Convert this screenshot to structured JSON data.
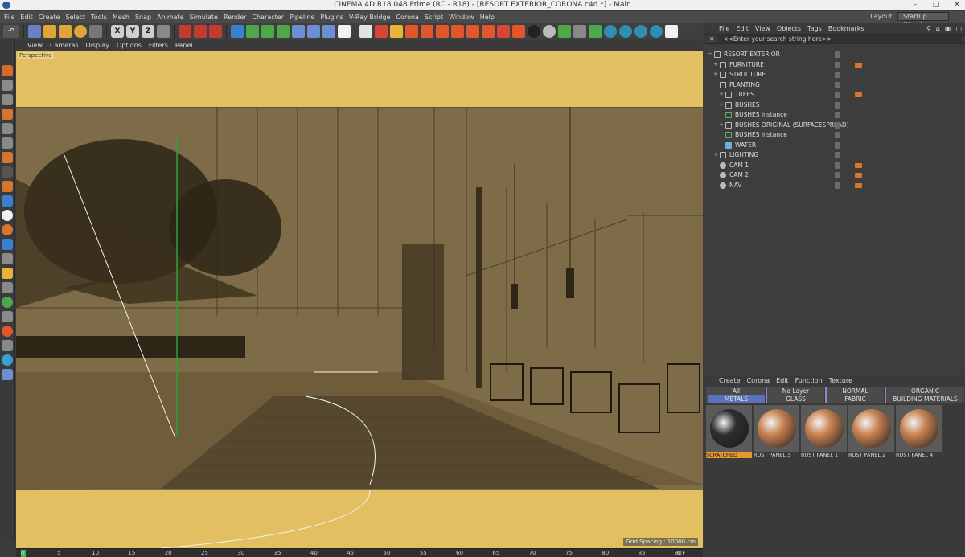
{
  "window": {
    "title": "CINEMA 4D R18.048 Prime (RC - R18) - [RESORT EXTERIOR_CORONA.c4d *] - Main",
    "controls": [
      "–",
      "□",
      "✕"
    ]
  },
  "menubar": {
    "items": [
      "File",
      "Edit",
      "Create",
      "Select",
      "Tools",
      "Mesh",
      "Snap",
      "Animate",
      "Simulate",
      "Render",
      "Character",
      "Pipeline",
      "Plugins",
      "V-Ray Bridge",
      "Corona",
      "Script",
      "Window",
      "Help"
    ],
    "layout_label": "Layout:",
    "layout_value": "Startup (User)"
  },
  "toolbar": {
    "axis_labels": [
      "X",
      "Y",
      "Z"
    ]
  },
  "viewport": {
    "menu": [
      "View",
      "Cameras",
      "Display",
      "Options",
      "Filters",
      "Panel"
    ],
    "label": "Perspective",
    "grid_spacing": "Grid Spacing : 10000 cm",
    "colors": {
      "background": "#e2c062",
      "scene": "#7e6c48"
    }
  },
  "timeline": {
    "ticks": [
      "0",
      "5",
      "10",
      "15",
      "20",
      "25",
      "30",
      "35",
      "40",
      "45",
      "50",
      "55",
      "60",
      "65",
      "70",
      "75",
      "80",
      "85",
      "90"
    ],
    "end_label": "0 F"
  },
  "object_manager": {
    "menu": [
      "File",
      "Edit",
      "View",
      "Objects",
      "Tags",
      "Bookmarks"
    ],
    "search_placeholder": "<<Enter your search string here>>",
    "objects": [
      {
        "name": "RESORT EXTERIOR",
        "depth": 0,
        "kind": "null",
        "expand": "−"
      },
      {
        "name": "FURNITURE",
        "depth": 1,
        "kind": "null",
        "expand": "+",
        "tag": "#d9742c"
      },
      {
        "name": "STRUCTURE",
        "depth": 1,
        "kind": "null",
        "expand": "+"
      },
      {
        "name": "PLANTING",
        "depth": 1,
        "kind": "null",
        "expand": "−"
      },
      {
        "name": "TREES",
        "depth": 2,
        "kind": "null",
        "expand": "+",
        "tag": "#d9742c"
      },
      {
        "name": "BUSHES",
        "depth": 2,
        "kind": "null",
        "expand": "+"
      },
      {
        "name": "BUSHES Instance",
        "depth": 2,
        "kind": "instance",
        "expand": ""
      },
      {
        "name": "BUSHES ORIGINAL (SURFACESPREAD)",
        "depth": 2,
        "kind": "null",
        "expand": "+"
      },
      {
        "name": "BUSHES Instance",
        "depth": 2,
        "kind": "instance",
        "expand": ""
      },
      {
        "name": "WATER",
        "depth": 2,
        "kind": "plane",
        "expand": ""
      },
      {
        "name": "LIGHTING",
        "depth": 1,
        "kind": "null",
        "expand": "+"
      },
      {
        "name": "CAM 1",
        "depth": 1,
        "kind": "camera",
        "expand": "",
        "tag": "#d9742c"
      },
      {
        "name": "CAM 2",
        "depth": 1,
        "kind": "camera",
        "expand": "",
        "tag": "#d9742c"
      },
      {
        "name": "NAV",
        "depth": 1,
        "kind": "camera",
        "expand": "",
        "tag": "#d9742c"
      }
    ]
  },
  "material_manager": {
    "menu": [
      "Create",
      "Corona",
      "Edit",
      "Function",
      "Texture"
    ],
    "filters_row1": [
      "All",
      "No Layer",
      "NORMAL",
      "ORGANIC"
    ],
    "filters_row2": [
      "METALS",
      "GLASS",
      "FABRIC",
      "BUILDING MATERIALS"
    ],
    "active_filter": "METALS",
    "materials": [
      {
        "name": "SCRATCHED",
        "color": "#2e2e2e",
        "selected": true
      },
      {
        "name": "RUST PANEL 3",
        "color": "#c98252",
        "selected": false
      },
      {
        "name": "RUST PANEL 1",
        "color": "#c98252",
        "selected": false
      },
      {
        "name": "RUST PANEL 2",
        "color": "#c98252",
        "selected": false
      },
      {
        "name": "RUST PANEL 4",
        "color": "#c98252",
        "selected": false
      }
    ]
  }
}
